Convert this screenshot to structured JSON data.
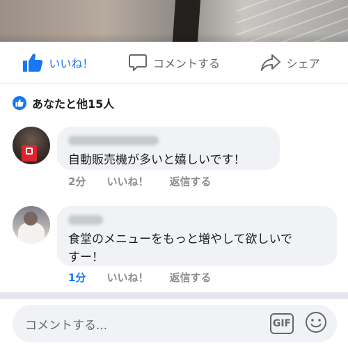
{
  "post_actions": {
    "like_label": "いいね！",
    "comment_label": "コメントする",
    "share_label": "シェア"
  },
  "reactions": {
    "summary": "あなたと他15人"
  },
  "comments": [
    {
      "text": "自動販売機が多いと嬉しいです！",
      "time": "2分",
      "like_label": "いいね！",
      "reply_label": "返信する"
    },
    {
      "text_line1": "食堂のメニューをもっと増やして欲しいで",
      "text_line2": "すー！",
      "time": "1分",
      "like_label": "いいね！",
      "reply_label": "返信する"
    }
  ],
  "composer": {
    "placeholder": "コメントする...",
    "gif_label": "GIF"
  },
  "colors": {
    "accent": "#1877f2",
    "muted": "#65676b",
    "bubble": "#f0f2f5"
  }
}
